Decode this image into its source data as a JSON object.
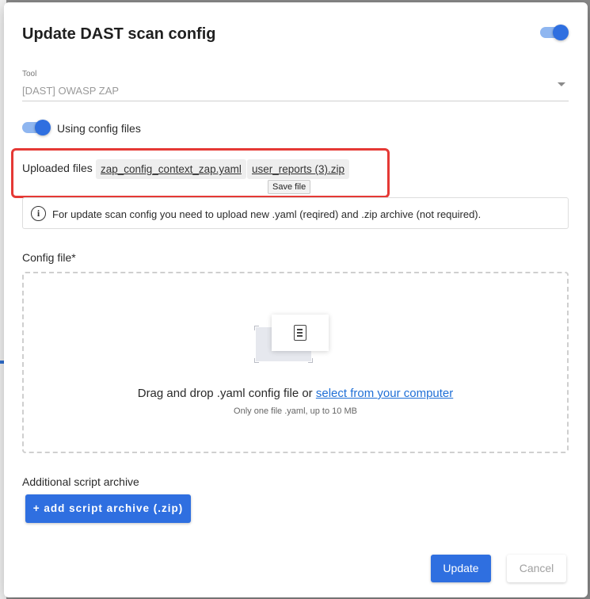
{
  "modal": {
    "title": "Update DAST scan config",
    "header_toggle_on": true
  },
  "tool": {
    "label": "Tool",
    "value": "[DAST] OWASP ZAP"
  },
  "config_files_toggle": {
    "label": "Using config files",
    "on": true
  },
  "uploaded": {
    "label": "Uploaded files",
    "files": [
      "zap_config_context_zap.yaml",
      "user_reports (3).zip"
    ],
    "tooltip": "Save file"
  },
  "info": {
    "icon": "info-icon",
    "text": "For update scan config you need to upload new .yaml (reqired) and .zip archive (not required)."
  },
  "config_file": {
    "label": "Config file*",
    "drop_text": "Drag and drop .yaml config file or",
    "drop_link": "select from your computer",
    "hint": "Only one file .yaml, up to 10 MB",
    "icon": "document-icon"
  },
  "archive": {
    "label": "Additional script archive",
    "button": "+ add script archive (.zip)"
  },
  "actions": {
    "update": "Update",
    "cancel": "Cancel"
  },
  "colors": {
    "accent": "#2f6fe0",
    "highlight_border": "#e53935"
  }
}
